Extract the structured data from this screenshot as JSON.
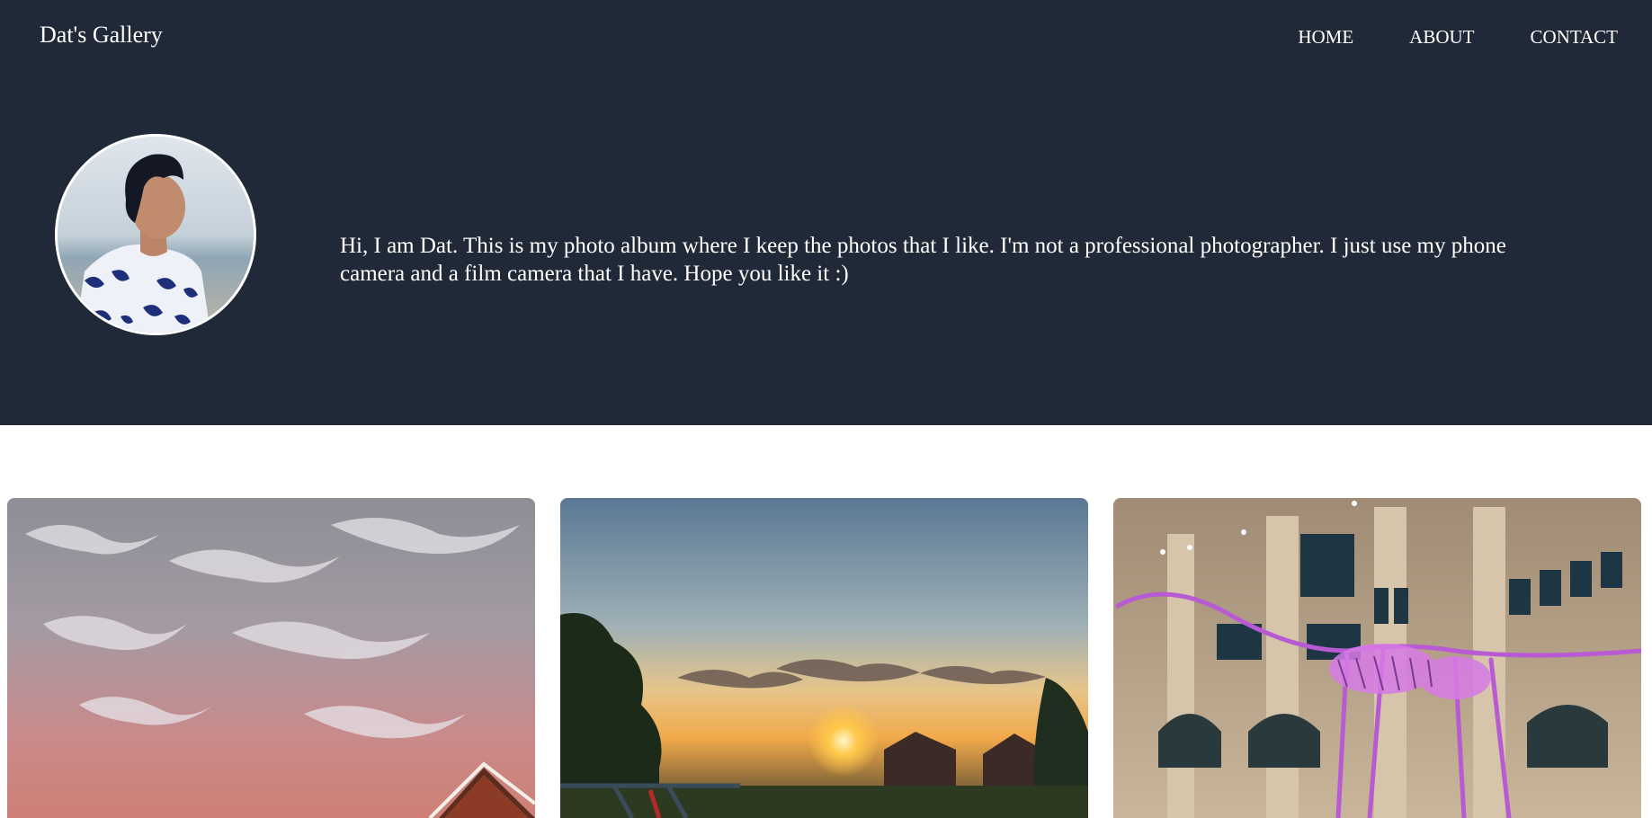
{
  "header": {
    "brand": "Dat's Gallery",
    "nav": [
      {
        "label": "HOME"
      },
      {
        "label": "ABOUT"
      },
      {
        "label": "CONTACT"
      }
    ]
  },
  "hero": {
    "avatar_icon": "profile-photo",
    "intro": "Hi, I am Dat. This is my photo album where I keep the photos that I like. I'm not a professional photographer. I just use my phone camera and a film camera that I have. Hope you like it :)"
  },
  "gallery": {
    "photos": [
      {
        "subject": "pink-sunset-clouds"
      },
      {
        "subject": "suburban-sunset"
      },
      {
        "subject": "dinosaur-skeleton-museum"
      }
    ]
  },
  "colors": {
    "hero_bg": "#1f2937",
    "text": "#ffffff",
    "page_bg": "#ffffff"
  }
}
